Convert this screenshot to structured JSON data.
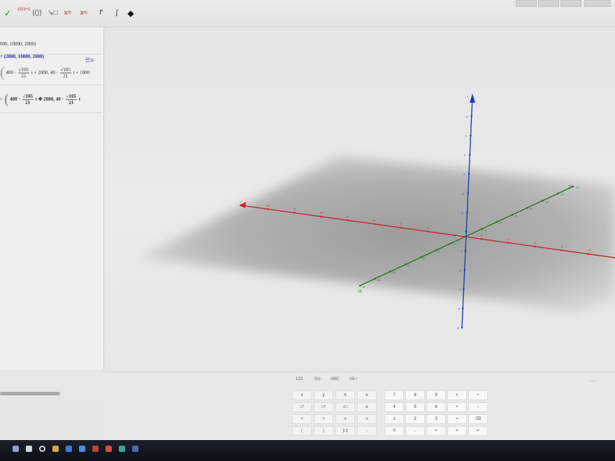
{
  "toolbar": {
    "items": [
      {
        "name": "check-icon",
        "label": "✓"
      },
      {
        "name": "fraction-tool",
        "label": "15/3÷5"
      },
      {
        "name": "parens-tool",
        "label": "(())"
      },
      {
        "name": "substitute-tool",
        "label": "↘□"
      },
      {
        "name": "solve-tool",
        "label": "x="
      },
      {
        "name": "numeric-solve-tool",
        "label": "x≈"
      },
      {
        "name": "derivative-tool",
        "label": "f'"
      },
      {
        "name": "integral-tool",
        "label": "∫"
      },
      {
        "name": "eraser-tool",
        "label": "◆"
      }
    ]
  },
  "algebra": {
    "toggle_label": "☰≡",
    "row1": "000, 10000, 2000)",
    "row2": "= (2000, 10000, 2000)",
    "row3": {
      "a": "400 ·",
      "sqrt": "√105",
      "den": "21",
      "mid": "t + 2000, 40 ·",
      "end": "t + 1000"
    },
    "row4": {
      "prefix": "=",
      "a": "400 ·",
      "sqrt": "√105",
      "den": "21",
      "mid": "t ✥ 2000, 40 ·",
      "end": "t"
    }
  },
  "graphics": {
    "x_axis_color": "#c62828",
    "y_axis_color": "#1e7a1e",
    "z_axis_color": "#1a3fb8",
    "x_labels": [
      "x",
      "14",
      "12",
      "10",
      "8",
      "6",
      "4",
      "2",
      "",
      "-2",
      "-4",
      "-6",
      "-8",
      "-10",
      "-12"
    ],
    "y_labels": [
      "14",
      "12",
      "10",
      "8",
      "6",
      "4",
      "2",
      "",
      "-2",
      "-4",
      "-6",
      "-8",
      "-10",
      "-12",
      "-14"
    ],
    "z_labels": [
      "7",
      "6",
      "5",
      "4",
      "3",
      "2",
      "1",
      "",
      "-1",
      "-2",
      "-3",
      "-4",
      "-5"
    ],
    "y_end_label": "16",
    "y_start_label": "15"
  },
  "keyboard": {
    "tabs": [
      "123",
      "f(x)",
      "ABC",
      "#&¬"
    ],
    "more": "···",
    "keys": [
      [
        "x",
        "y",
        "π",
        "e"
      ],
      [
        "□²",
        "□ⁿ",
        "√□",
        "e"
      ],
      [
        "<",
        ">",
        "≤",
        "≥"
      ],
      [
        "(",
        ")",
        "|□|",
        ","
      ]
    ],
    "numpad": [
      [
        "7",
        "8",
        "9",
        "×",
        "÷"
      ],
      [
        "4",
        "5",
        "6",
        "+",
        "−"
      ],
      [
        "1",
        "2",
        "3",
        "=",
        "⌫"
      ],
      [
        "0",
        ".",
        "<",
        ">",
        "↵"
      ]
    ]
  },
  "taskbar": {
    "icons": [
      "windows-icon",
      "search-icon",
      "taskview-icon",
      "explorer-icon",
      "store-icon",
      "mail-icon",
      "office-icon",
      "chrome-icon",
      "geogebra-icon",
      "app-icon"
    ]
  }
}
